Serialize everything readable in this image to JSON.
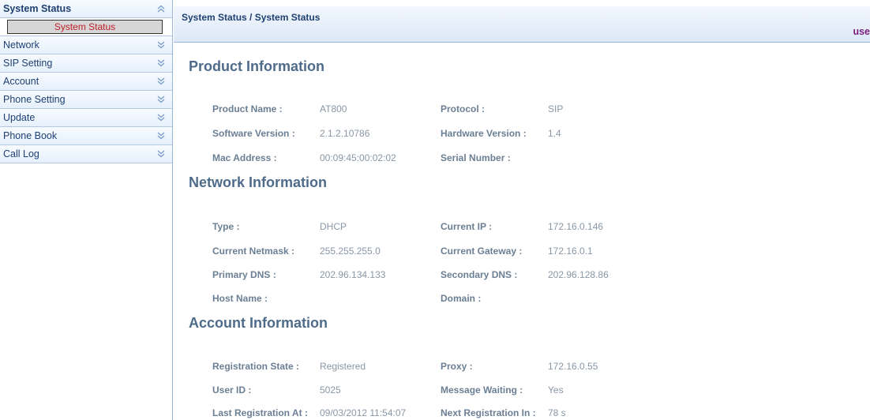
{
  "sidebar": {
    "items": [
      {
        "label": "System Status",
        "expanded": true,
        "sub": [
          "System Status"
        ]
      },
      {
        "label": "Network",
        "expanded": false
      },
      {
        "label": "SIP Setting",
        "expanded": false
      },
      {
        "label": "Account",
        "expanded": false
      },
      {
        "label": "Phone Setting",
        "expanded": false
      },
      {
        "label": "Update",
        "expanded": false
      },
      {
        "label": "Phone Book",
        "expanded": false
      },
      {
        "label": "Call Log",
        "expanded": false
      }
    ]
  },
  "header": {
    "breadcrumb": "System Status / System Status",
    "user_text": "use"
  },
  "sections": {
    "product": {
      "title": "Product Information",
      "rows": [
        {
          "l1": "Product Name :",
          "v1": "AT800",
          "l2": "Protocol :",
          "v2": "SIP"
        },
        {
          "l1": "Software Version :",
          "v1": "2.1.2.10786",
          "l2": "Hardware Version :",
          "v2": "1.4"
        },
        {
          "l1": "Mac Address :",
          "v1": "00:09:45:00:02:02",
          "l2": "Serial Number :",
          "v2": ""
        }
      ]
    },
    "network": {
      "title": "Network Information",
      "rows": [
        {
          "l1": "Type :",
          "v1": "DHCP",
          "l2": "Current IP :",
          "v2": "172.16.0.146"
        },
        {
          "l1": "Current Netmask :",
          "v1": "255.255.255.0",
          "l2": "Current Gateway :",
          "v2": "172.16.0.1"
        },
        {
          "l1": "Primary DNS :",
          "v1": "202.96.134.133",
          "l2": "Secondary DNS :",
          "v2": "202.96.128.86"
        },
        {
          "l1": "Host Name :",
          "v1": "",
          "l2": "Domain :",
          "v2": ""
        }
      ]
    },
    "account": {
      "title": "Account Information",
      "rows": [
        {
          "l1": "Registration State :",
          "v1": "Registered",
          "l2": "Proxy :",
          "v2": "172.16.0.55"
        },
        {
          "l1": "User ID :",
          "v1": "5025",
          "l2": "Message Waiting :",
          "v2": "Yes"
        },
        {
          "l1": "Last Registration At :",
          "v1": "09/03/2012 11:54:07",
          "l2": "Next Registration In :",
          "v2": "78 s"
        }
      ]
    }
  },
  "icons": {
    "collapse": "chevron-double-up-icon",
    "expand": "chevron-double-down-icon"
  },
  "colors": {
    "link": "#7b1f7e",
    "active_sub": "#c0202a",
    "heading": "#1f3f72"
  }
}
